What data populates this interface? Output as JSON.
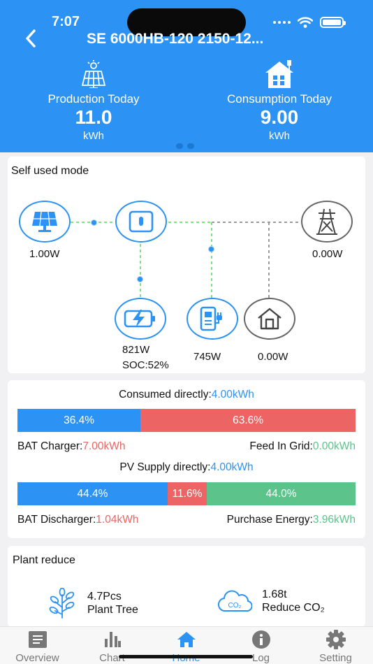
{
  "status": {
    "time": "7:07"
  },
  "header": {
    "title": "SE 6000HB-120 2150-12...",
    "production": {
      "label": "Production Today",
      "value": "11.0",
      "unit": "kWh"
    },
    "consumption": {
      "label": "Consumption Today",
      "value": "9.00",
      "unit": "kWh"
    },
    "pager": {
      "pages": 2,
      "current": 1
    }
  },
  "flow": {
    "mode": "Self used mode",
    "pv": {
      "value": "1.00W",
      "icon": "solar-panel-icon"
    },
    "inverter": {
      "icon": "inverter-icon"
    },
    "grid": {
      "value": "0.00W",
      "icon": "power-tower-icon"
    },
    "battery": {
      "value": "821W",
      "soc": "SOC:52%",
      "icon": "battery-charging-icon"
    },
    "backup_load": {
      "value": "745W",
      "icon": "ev-charger-icon"
    },
    "home_load": {
      "value": "0.00W",
      "icon": "house-icon"
    }
  },
  "energy": {
    "consumed_label": "Consumed directly:",
    "consumed_value": "4.00kWh",
    "bar1": [
      {
        "label": "36.4%",
        "percent": 36.4,
        "color": "#2c93f5"
      },
      {
        "label": "63.6%",
        "percent": 63.6,
        "color": "#ec6464"
      }
    ],
    "bat_charger_label": "BAT Charger:",
    "bat_charger_value": "7.00kWh",
    "feed_in_label": "Feed In Grid:",
    "feed_in_value": "0.00kWh",
    "pv_supply_label": "PV Supply directly:",
    "pv_supply_value": "4.00kWh",
    "bar2": [
      {
        "label": "44.4%",
        "percent": 44.4,
        "color": "#2c93f5"
      },
      {
        "label": "11.6%",
        "percent": 11.6,
        "color": "#ec6464"
      },
      {
        "label": "44.0%",
        "percent": 44.0,
        "color": "#5cc38b"
      }
    ],
    "bat_discharger_label": "BAT Discharger:",
    "bat_discharger_value": "1.04kWh",
    "purchase_label": "Purchase Energy:",
    "purchase_value": "3.96kWh"
  },
  "plant": {
    "title": "Plant reduce",
    "tree_value": "4.7Pcs",
    "tree_label": "Plant Tree",
    "co2_value": "1.68t",
    "co2_label": "Reduce CO₂",
    "co2_badge": "CO₂"
  },
  "nav": [
    {
      "label": "Overview",
      "icon": "overview-icon"
    },
    {
      "label": "Chart",
      "icon": "bar-chart-icon"
    },
    {
      "label": "Home",
      "icon": "home-icon",
      "active": true
    },
    {
      "label": "Log",
      "icon": "info-icon"
    },
    {
      "label": "Setting",
      "icon": "gear-icon"
    }
  ]
}
